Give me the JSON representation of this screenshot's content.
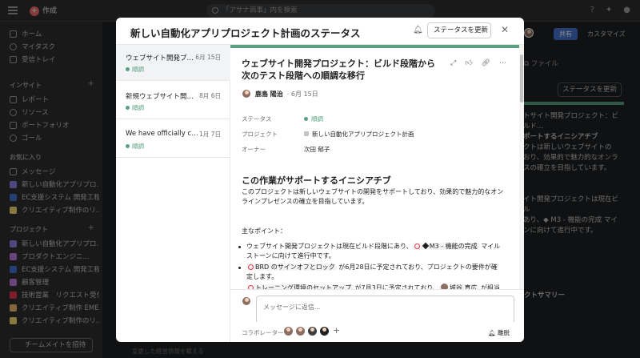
{
  "topbar": {
    "create_label": "作成",
    "search_placeholder": "「アサナ商事」内を検索"
  },
  "sidebar": {
    "items_top": [
      "ホーム",
      "マイタスク",
      "受信トレイ"
    ],
    "insights_header": "インサイト",
    "insights": [
      "レポート",
      "リソース",
      "ポートフォリオ",
      "ゴール"
    ],
    "favorites_header": "お気に入り",
    "favorites": [
      {
        "label": "メッセージ",
        "color": ""
      },
      {
        "label": "新しい自動化アプリプロ...",
        "color": "#8d84e8"
      },
      {
        "label": "EC支援システム 開発工程",
        "color": "#4573d2"
      },
      {
        "label": "クリエイティブ制作のリ...",
        "color": "#f8df72"
      }
    ],
    "projects_header": "プロジェクト",
    "projects": [
      {
        "label": "新しい自動化アプリプロ...",
        "color": "#8d84e8"
      },
      {
        "label": "プロダクトエンジニ...",
        "color": "#c27de3"
      },
      {
        "label": "EC支援システム 開発工程",
        "color": "#4573d2"
      },
      {
        "label": "顧客管理",
        "color": "#c27de3"
      },
      {
        "label": "技術営業　リクエスト受付",
        "color": "#e8384f"
      },
      {
        "label": "クリエイティブ制作 EMEA",
        "color": "#f1bd6c"
      },
      {
        "label": "クリエイティブ制作のリ...",
        "color": "#f8df72"
      }
    ],
    "invite_label": "チームメイトを招待"
  },
  "background": {
    "share_label": "共有",
    "customize_label": "カスタマイズ",
    "files_tab": "ファイル",
    "status_button": "ステータスを更新",
    "card_lines": [
      "トサイト開発プロジェクト：ビルド...",
      "",
      "ポートするイニシアチブ",
      "クトは新しいウェブサイトの",
      "おり、効果的で魅力的なオンラ",
      "スの確立を目指しています。",
      "",
      "",
      "イト開発プロジェクトは現在ビル",
      "あり、◆ M3 - 機能の完成 マイ",
      "ンに向けて進行中です。"
    ],
    "summary_label": "クトサマリー",
    "bottom_hint": "変更した経営情報を載える"
  },
  "modal": {
    "title": "新しい自動化アプリプロジェクト計画のステータス",
    "update_button": "ステータスを更新",
    "list": [
      {
        "title": "ウェブサイト開発プロジ...",
        "date": "6月 15日",
        "status": "順調"
      },
      {
        "title": "新規ウェブサイト開発プ...",
        "date": "8月 6日",
        "status": "順調"
      },
      {
        "title": "We have officially complet...",
        "date": "1月 7日",
        "status": "順調"
      }
    ],
    "detail": {
      "title": "ウェブサイト開発プロジェクト：ビルド段階から次のテスト段階への順調な移行",
      "author": "鹿島 陽治",
      "date": "· 6月 15日",
      "fields": [
        {
          "label": "ステータス",
          "value": "順調"
        },
        {
          "label": "プロジェクト",
          "value": "新しい自動化アプリプロジェクト計画"
        },
        {
          "label": "オーナー",
          "value": "次田 郁子"
        }
      ],
      "heading": "この作業がサポートするイニシアチブ",
      "body": "このプロジェクトは新しいウェブサイトの開発をサポートしており、効果的で魅力的なオンラインプレゼンスの確立を目指しています。",
      "points_label": "主なポイント：",
      "bullet1_a": "ウェブサイト開発プロジェクトは現在ビルド段階にあり、",
      "bullet1_chip": "M3 - 機能の完成",
      "bullet1_b": " マイルストーンに向けて進行中です。",
      "bullet2_chip": "BRD のサインオフとロック",
      "bullet2_b": " が6月28日に予定されており、プロジェクトの要件が確定します。",
      "bullet3_chip": "トレーニング環境のセットアップ",
      "bullet3_b": " が7月3日に予定されており、",
      "bullet3_person": "城谷 真広",
      "bullet3_c": " が担当しています。"
    },
    "reply_placeholder": "メッセージに返信...",
    "collaborators_label": "コラボレーター",
    "leave_label": "離脱"
  }
}
